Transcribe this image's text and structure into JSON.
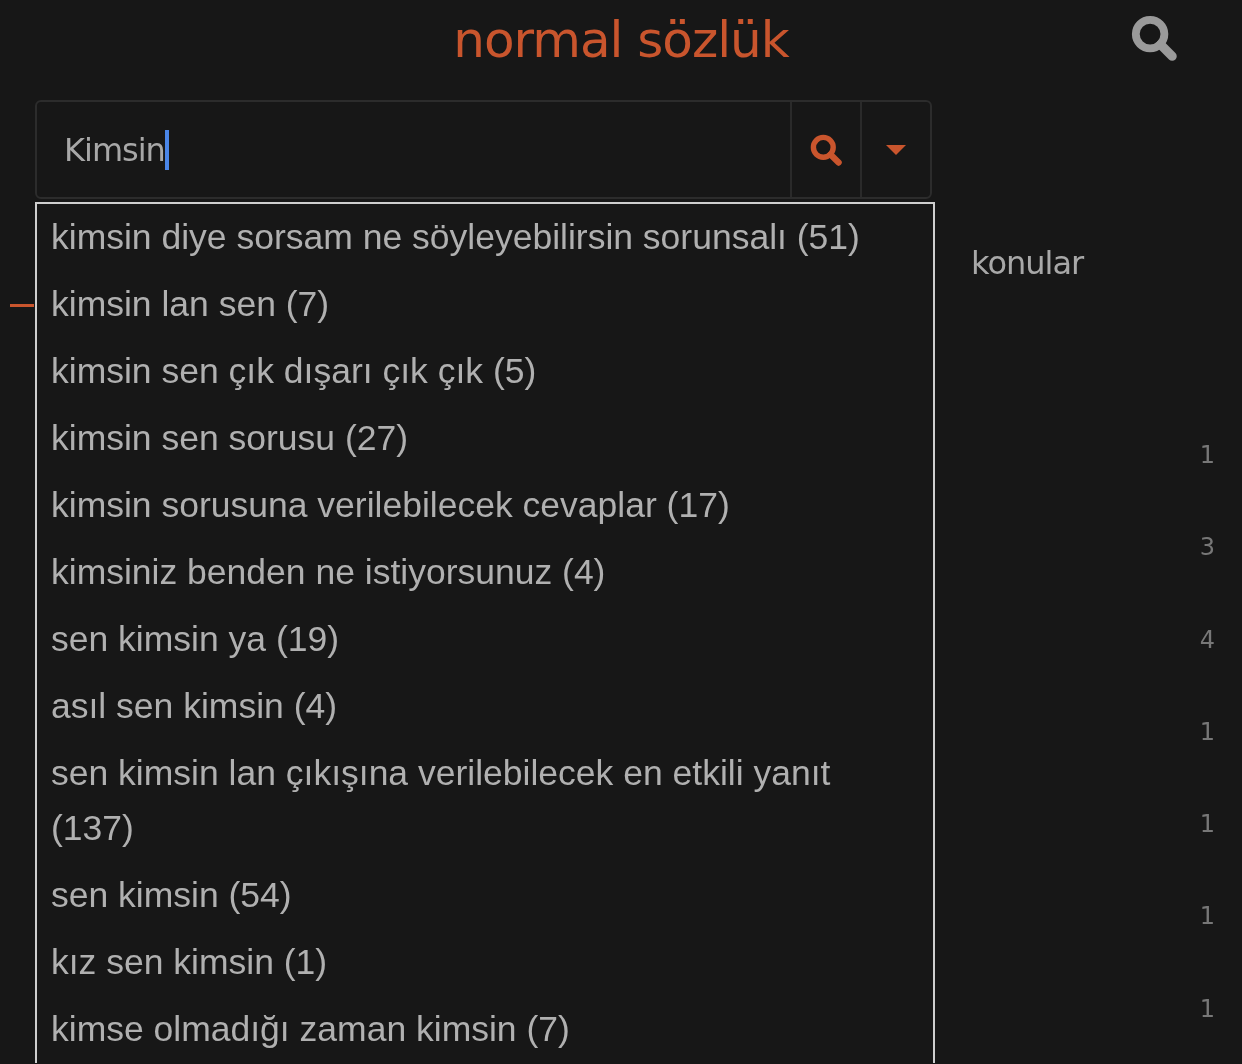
{
  "header": {
    "title": "normal sözlük"
  },
  "search": {
    "value": "Kimsin"
  },
  "suggestions": [
    {
      "text": "kimsin diye sorsam ne söyleyebilirsin sorunsalı (51)"
    },
    {
      "text": "kimsin lan sen (7)"
    },
    {
      "text": "kimsin sen çık dışarı çık çık (5)"
    },
    {
      "text": "kimsin sen sorusu (27)"
    },
    {
      "text": "kimsin sorusuna verilebilecek cevaplar (17)"
    },
    {
      "text": "kimsiniz benden ne istiyorsunuz (4)"
    },
    {
      "text": "sen kimsin ya (19)"
    },
    {
      "text": "asıl sen kimsin (4)"
    },
    {
      "text": "sen kimsin lan çıkışına verilebilecek en etkili yanıt (137)"
    },
    {
      "text": "sen kimsin (54)"
    },
    {
      "text": "kız sen kimsin (1)"
    },
    {
      "text": "kimse olmadığı zaman kimsin (7)"
    }
  ],
  "sidebar": {
    "heading": "konular",
    "counts": [
      "1",
      "3",
      "4",
      "1",
      "1",
      "1",
      "1"
    ]
  }
}
